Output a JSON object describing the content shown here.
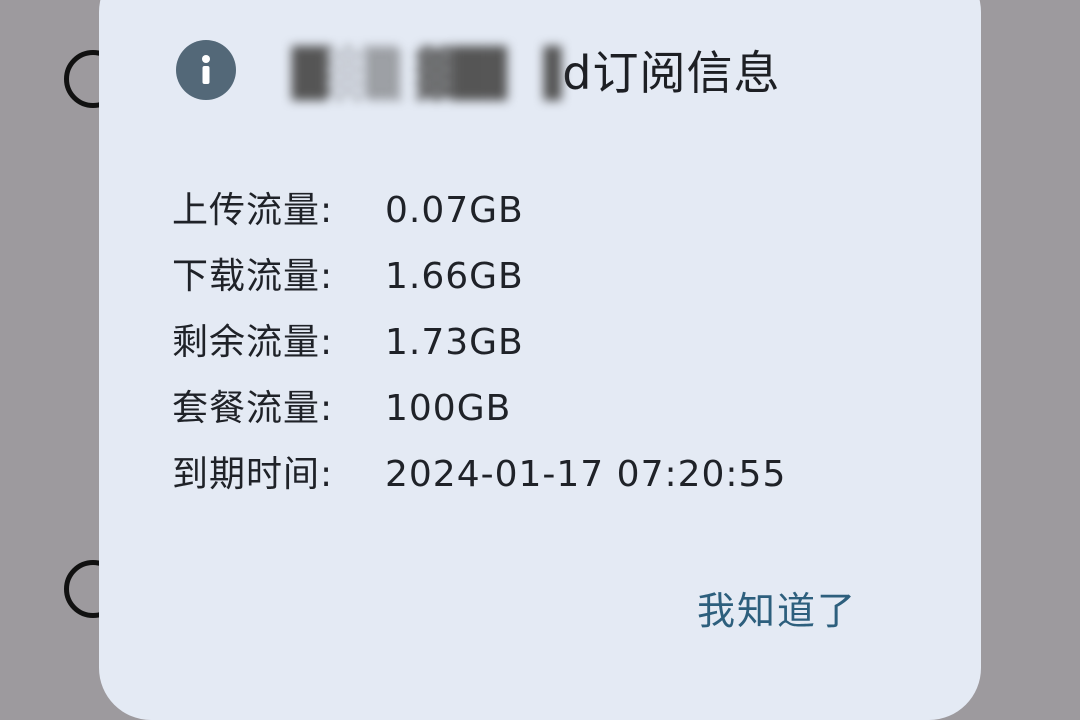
{
  "dialog": {
    "title_prefix_obscured": "█░▒ ▓█▌▐",
    "title_visible": "d订阅信息",
    "icon": "info-icon",
    "rows": [
      {
        "label": "上传流量:",
        "value": "0.07GB"
      },
      {
        "label": "下载流量:",
        "value": "1.66GB"
      },
      {
        "label": "剩余流量:",
        "value": "1.73GB"
      },
      {
        "label": "套餐流量:",
        "value": "100GB"
      },
      {
        "label": "到期时间:",
        "value": "2024-01-17 07:20:55"
      }
    ],
    "confirm_label": "我知道了"
  },
  "colors": {
    "dialog_bg": "#e4eaf4",
    "icon_bg": "#536878",
    "button_text": "#2d5f7d",
    "scrim": "#9d9a9e"
  }
}
